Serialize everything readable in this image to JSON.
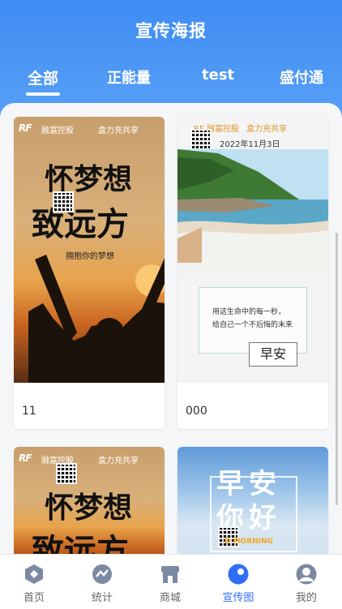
{
  "header": {
    "title": "宣传海报"
  },
  "tabs": [
    {
      "label": "全部"
    },
    {
      "label": "正能量"
    },
    {
      "label": "test"
    },
    {
      "label": "盛付通"
    }
  ],
  "cards": [
    {
      "label": "11",
      "poster": {
        "brand_left": "融富控股",
        "brand_right": "盒力充共享",
        "logo": "RF",
        "headline_1": "怀梦想",
        "headline_2": "致远方",
        "slogan": "拥抱你的梦想"
      }
    },
    {
      "label": "000",
      "poster": {
        "brand_left": "融富控股",
        "brand_right": "盒力充共享",
        "logo": "RF",
        "date": "2022年11月3日",
        "line_1": "用这生命中的每一秒，",
        "line_2": "给自己一个不后悔的未来",
        "stamp": "早安"
      }
    },
    {
      "label": "",
      "poster": {
        "brand_left": "融富控股",
        "brand_right": "盒力充共享",
        "logo": "RF",
        "headline_1": "怀梦想",
        "headline_2": "致远方"
      }
    },
    {
      "label": "",
      "poster": {
        "headline_1": "早安",
        "headline_2": "你好",
        "tagline": "D MORNING"
      }
    }
  ],
  "nav": [
    {
      "label": "首页",
      "icon": "home-hexagon-icon"
    },
    {
      "label": "统计",
      "icon": "stats-icon"
    },
    {
      "label": "商城",
      "icon": "shop-icon"
    },
    {
      "label": "宣传图",
      "icon": "poster-icon"
    },
    {
      "label": "我的",
      "icon": "user-icon"
    }
  ],
  "colors": {
    "accent": "#2f6ef5",
    "header": "#4a94f5"
  }
}
